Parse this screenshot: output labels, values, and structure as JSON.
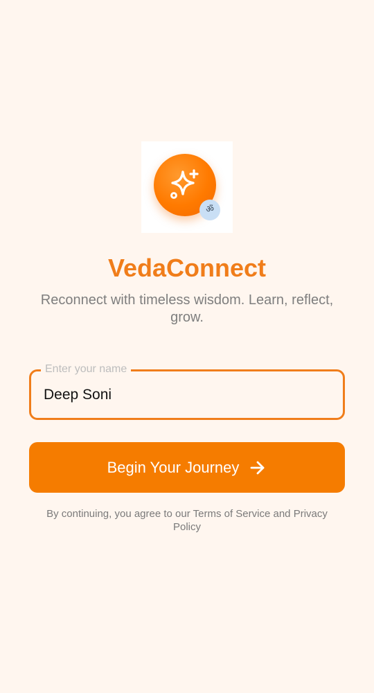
{
  "app": {
    "title": "VedaConnect",
    "tagline": "Reconnect with timeless wisdom. Learn, reflect, grow.",
    "logo_icon": "sparkles-icon",
    "badge_icon": "om-icon",
    "badge_glyph": "ॐ"
  },
  "name_field": {
    "label": "Enter your name",
    "value": "Deep Soni"
  },
  "cta": {
    "label": "Begin Your Journey",
    "icon": "arrow-right-icon"
  },
  "legal": {
    "prefix": "By continuing, you agree to our ",
    "terms_link": "Terms of Service",
    "and": " and ",
    "privacy_link": "Privacy Policy"
  },
  "colors": {
    "background": "#FFF6EF",
    "accent": "#F57C00",
    "title": "#F07D1A",
    "muted_text": "#7E7E7E",
    "badge_bg": "#C9DFF5"
  }
}
